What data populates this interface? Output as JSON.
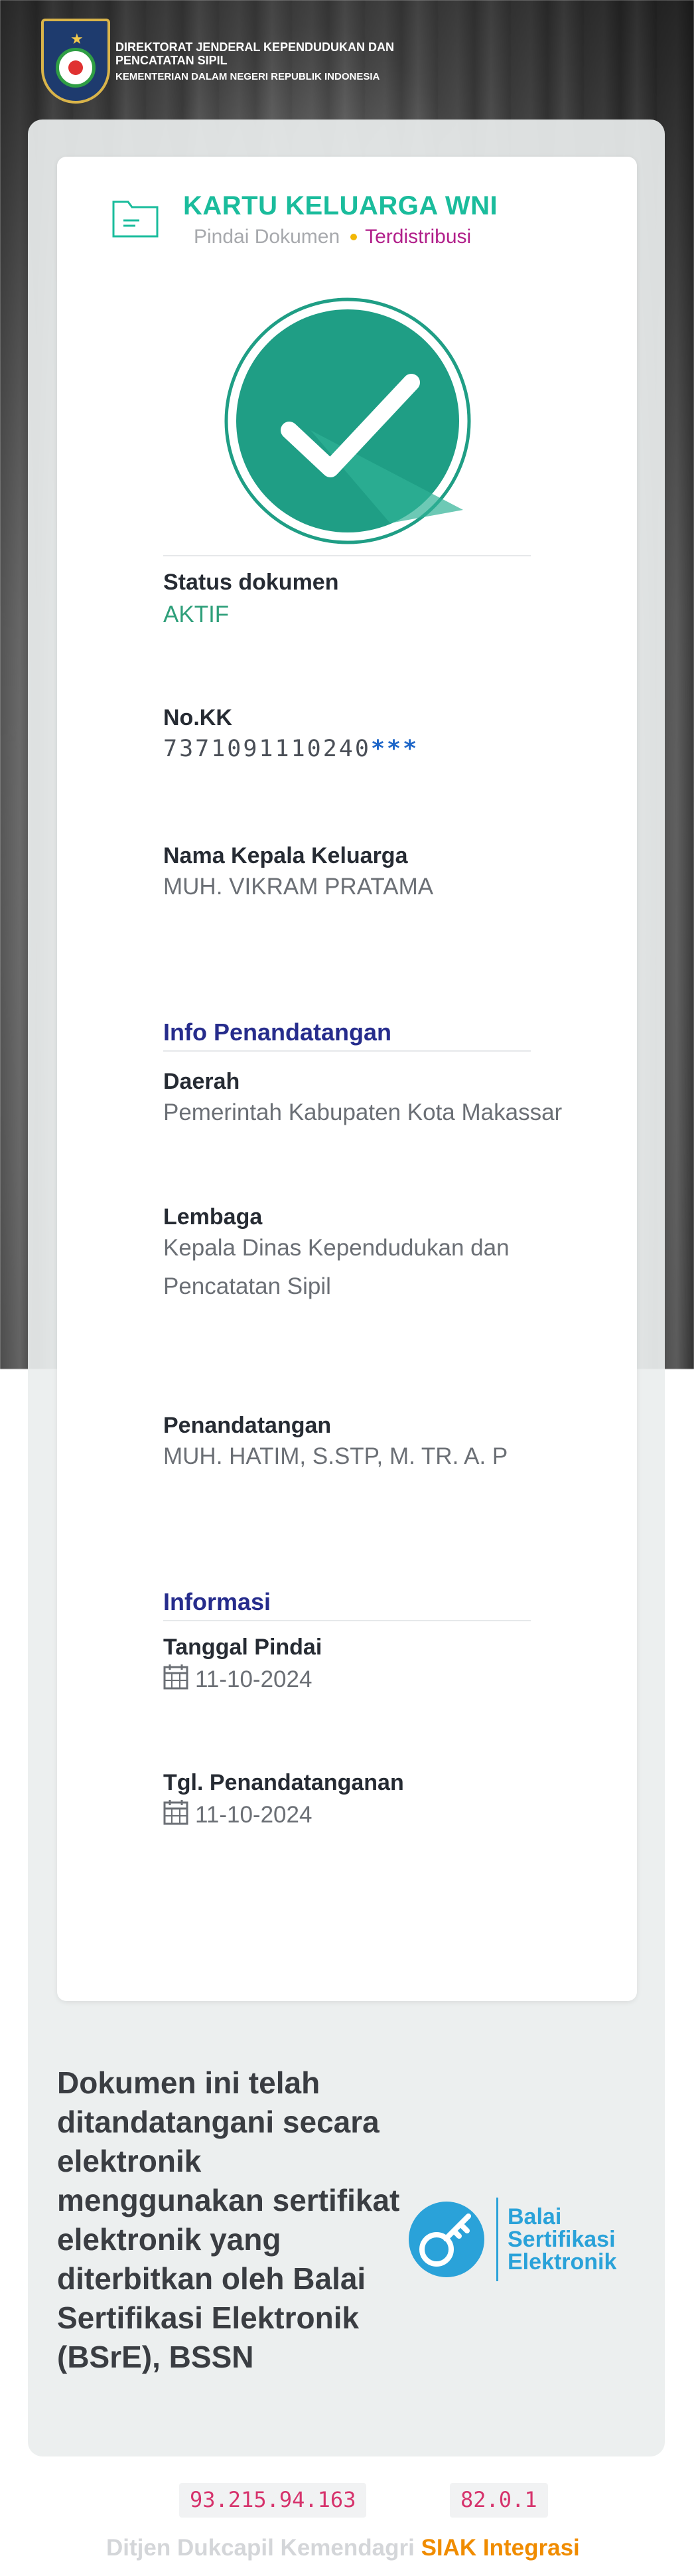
{
  "header": {
    "org_line1": "DIREKTORAT JENDERAL KEPENDUDUKAN DAN PENCATATAN SIPIL",
    "org_line2": "KEMENTERIAN DALAM NEGERI REPUBLIK INDONESIA"
  },
  "document": {
    "title": "KARTU KELUARGA WNI",
    "step_1": "Pindai Dokumen",
    "step_2": "Terdistribusi",
    "status_icon": "check-circle-icon"
  },
  "fields": {
    "status_label": "Status dokumen",
    "status_value": "AKTIF",
    "no_kk_label": "No.KK",
    "no_kk_value": "7371091110240",
    "no_kk_mask": "***",
    "kepala_label": "Nama Kepala Keluarga",
    "kepala_value": "MUH. VIKRAM PRATAMA"
  },
  "signing": {
    "section_title": "Info Penandatangan",
    "daerah_label": "Daerah",
    "daerah_value": "Pemerintah Kabupaten Kota Makassar",
    "lembaga_label": "Lembaga",
    "lembaga_value_1": "Kepala Dinas Kependudukan dan",
    "lembaga_value_2": "Pencatatan Sipil",
    "penandatangan_label": "Penandatangan",
    "penandatangan_value": "MUH. HATIM, S.STP, M. TR. A. P"
  },
  "info": {
    "section_title": "Informasi",
    "pindai_label": "Tanggal Pindai",
    "pindai_value": "11-10-2024",
    "ttd_label": "Tgl. Penandatanganan",
    "ttd_value": "11-10-2024"
  },
  "signed_notice": "Dokumen ini telah ditandatangani secara elektronik menggunakan sertifikat elektronik yang diterbitkan oleh Balai Sertifikasi Elektronik (BSrE), BSSN",
  "bsre": {
    "line1": "Balai",
    "line2": "Sertifikasi",
    "line3": "Elektronik"
  },
  "footer": {
    "ip": "93.215.94.163",
    "version": "82.0.1",
    "credit": "Ditjen Dukcapil Kemendagri",
    "brand": "SIAK Integrasi"
  },
  "colors": {
    "accent": "#1abc9c",
    "status": "#2e9f7a",
    "section": "#262c8c",
    "brand": "#f08c00",
    "bsre": "#2aa2d9"
  }
}
